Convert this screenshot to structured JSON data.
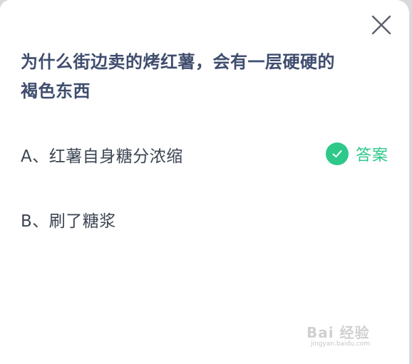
{
  "question": {
    "line1": "为什么街边卖的烤红薯，会有一层硬硬的",
    "line2": "褐色东西"
  },
  "options": [
    {
      "text": "A、红薯自身糖分浓缩",
      "is_answer": true
    },
    {
      "text": "B、刷了糖浆",
      "is_answer": false
    }
  ],
  "answer_label": "答案",
  "icons": {
    "close": "close-icon",
    "check": "check-circle-icon"
  },
  "colors": {
    "question_text": "#3f4d6e",
    "option_text": "#3b4452",
    "answer_green": "#2ec88a"
  },
  "watermark": {
    "main": "Bai 经验",
    "sub": "jingyan.baidu.com"
  }
}
